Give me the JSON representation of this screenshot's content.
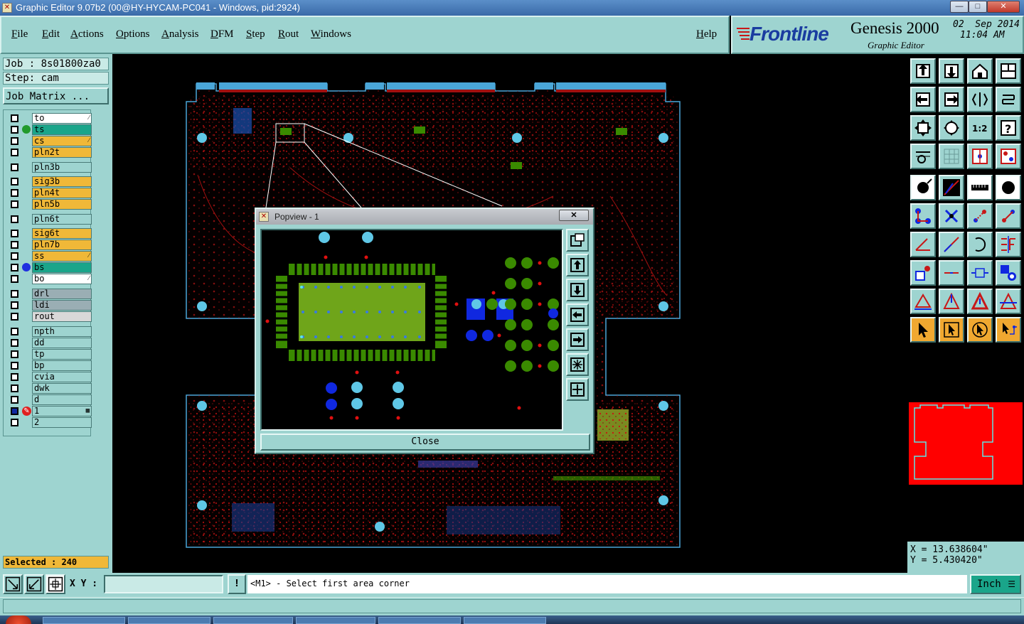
{
  "window": {
    "title": "Graphic Editor 9.07b2 (00@HY-HYCAM-PC041 - Windows, pid:2924)",
    "minimize": "—",
    "maximize": "□",
    "close": "✕"
  },
  "menu": {
    "items": [
      "File",
      "Edit",
      "Actions",
      "Options",
      "Analysis",
      "DFM",
      "Step",
      "Rout",
      "Windows"
    ],
    "help": "Help"
  },
  "brand": {
    "logo": "Frontline",
    "product": "Genesis 2000",
    "subtitle": "Graphic Editor",
    "date": "02  Sep 2014",
    "time": "11:04 AM"
  },
  "job": {
    "job_line": "Job : 8s01800za0",
    "step_line": "Step: cam",
    "matrix_button": "Job Matrix ..."
  },
  "layers": [
    {
      "name": "to",
      "bg": "#ffffff",
      "dot": "",
      "mark": "⁄"
    },
    {
      "name": "ts",
      "bg": "#1aa58a",
      "dot": "#229a2c",
      "mark": ""
    },
    {
      "name": "cs",
      "bg": "#f0b838",
      "dot": "",
      "mark": "⁄"
    },
    {
      "name": "pln2t",
      "bg": "#f0b838",
      "dot": "",
      "mark": ""
    },
    {
      "name": "pln3b",
      "bg": "#9ed4d0",
      "dot": "",
      "mark": ""
    },
    {
      "name": "sig3b",
      "bg": "#f0b838",
      "dot": "",
      "mark": ""
    },
    {
      "name": "pln4t",
      "bg": "#f0b838",
      "dot": "",
      "mark": ""
    },
    {
      "name": "pln5b",
      "bg": "#f0b838",
      "dot": "",
      "mark": ""
    },
    {
      "name": "pln6t",
      "bg": "#9ed4d0",
      "dot": "",
      "mark": ""
    },
    {
      "name": "sig6t",
      "bg": "#f0b838",
      "dot": "",
      "mark": ""
    },
    {
      "name": "pln7b",
      "bg": "#f0b838",
      "dot": "",
      "mark": ""
    },
    {
      "name": "ss",
      "bg": "#f0b838",
      "dot": "",
      "mark": "⁄"
    },
    {
      "name": "bs",
      "bg": "#1aa58a",
      "dot": "#2030e0",
      "mark": ""
    },
    {
      "name": "bo",
      "bg": "#ffffff",
      "dot": "",
      "mark": "⁄"
    },
    {
      "name": "drl",
      "bg": "#9aaeb4",
      "dot": "",
      "mark": ""
    },
    {
      "name": "ldi",
      "bg": "#9aaeb4",
      "dot": "",
      "mark": ""
    },
    {
      "name": "rout",
      "bg": "#d8d8d8",
      "dot": "",
      "mark": ""
    },
    {
      "name": "npth",
      "bg": "#9ed4d0",
      "dot": "",
      "mark": ""
    },
    {
      "name": "dd",
      "bg": "#9ed4d0",
      "dot": "",
      "mark": ""
    },
    {
      "name": "tp",
      "bg": "#9ed4d0",
      "dot": "",
      "mark": ""
    },
    {
      "name": "bp",
      "bg": "#9ed4d0",
      "dot": "",
      "mark": ""
    },
    {
      "name": "cvia",
      "bg": "#9ed4d0",
      "dot": "",
      "mark": ""
    },
    {
      "name": "dwk",
      "bg": "#9ed4d0",
      "dot": "",
      "mark": ""
    },
    {
      "name": "d",
      "bg": "#9ed4d0",
      "dot": "",
      "mark": ""
    },
    {
      "name": "1",
      "bg": "#9ed4d0",
      "dot": "",
      "mark": "▦"
    },
    {
      "name": "2",
      "bg": "#9ed4d0",
      "dot": "",
      "mark": ""
    }
  ],
  "selected": "Selected : 240",
  "popview": {
    "title": "Popview - 1",
    "close_x": "✕",
    "close_button": "Close"
  },
  "coords": {
    "x": "X =  13.638604\"",
    "y": "Y =  5.430420\""
  },
  "bottom": {
    "xy_label": "X Y :",
    "xy_value": "",
    "warn": "!",
    "prompt": "<M1> - Select first area corner",
    "units": "Inch"
  },
  "colors": {
    "panel": "#9ed4d0",
    "board_outline": "#4aa6d8",
    "trace_red": "#cc1010",
    "pad_green": "#3a8a00",
    "pad_cyan": "#5fc7e6",
    "pad_blue": "#1028e0",
    "accent_orange": "#f0a830",
    "overview_red": "#ff0000"
  }
}
